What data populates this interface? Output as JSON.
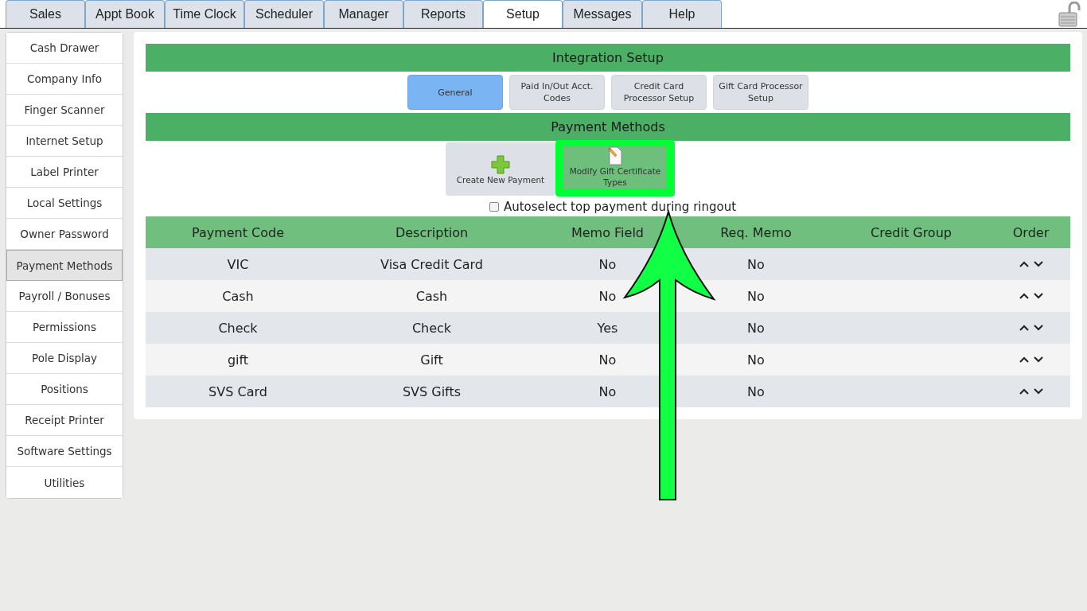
{
  "tabs": [
    {
      "label": "Sales",
      "selected": false
    },
    {
      "label": "Appt Book",
      "selected": false
    },
    {
      "label": "Time Clock",
      "selected": false
    },
    {
      "label": "Scheduler",
      "selected": false
    },
    {
      "label": "Manager",
      "selected": false
    },
    {
      "label": "Reports",
      "selected": false
    },
    {
      "label": "Setup",
      "selected": true
    },
    {
      "label": "Messages",
      "selected": false
    },
    {
      "label": "Help",
      "selected": false
    }
  ],
  "sidebar": {
    "items": [
      {
        "label": "Cash Drawer",
        "selected": false
      },
      {
        "label": "Company Info",
        "selected": false
      },
      {
        "label": "Finger Scanner",
        "selected": false
      },
      {
        "label": "Internet Setup",
        "selected": false
      },
      {
        "label": "Label Printer",
        "selected": false
      },
      {
        "label": "Local Settings",
        "selected": false
      },
      {
        "label": "Owner Password",
        "selected": false
      },
      {
        "label": "Payment Methods",
        "selected": true
      },
      {
        "label": "Payroll / Bonuses",
        "selected": false
      },
      {
        "label": "Permissions",
        "selected": false
      },
      {
        "label": "Pole Display",
        "selected": false
      },
      {
        "label": "Positions",
        "selected": false
      },
      {
        "label": "Receipt Printer",
        "selected": false
      },
      {
        "label": "Software Settings",
        "selected": false
      },
      {
        "label": "Utilities",
        "selected": false
      }
    ]
  },
  "integration": {
    "title": "Integration Setup",
    "buttons": [
      {
        "label": "General",
        "selected": true
      },
      {
        "label": "Paid In/Out Acct. Codes",
        "selected": false
      },
      {
        "label": "Credit Card Processor Setup",
        "selected": false
      },
      {
        "label": "Gift Card Processor Setup",
        "selected": false
      }
    ]
  },
  "payment_methods": {
    "title": "Payment Methods",
    "actions": [
      {
        "label": "Create New Payment",
        "kind": "plus",
        "highlighted": false
      },
      {
        "label": "Modify Gift Certificate Types",
        "kind": "edit",
        "highlighted": true
      }
    ],
    "autoselect": {
      "label": "Autoselect top payment during ringout",
      "checked": false
    }
  },
  "table": {
    "columns": [
      "Payment Code",
      "Description",
      "Memo Field",
      "Req. Memo",
      "Credit Group",
      "Order"
    ],
    "rows": [
      [
        "VIC",
        "Visa Credit Card",
        "No",
        "No"
      ],
      [
        "Cash",
        "Cash",
        "No",
        "No"
      ],
      [
        "Check",
        "Check",
        "Yes",
        "No"
      ],
      [
        "gift",
        "Gift",
        "No",
        "No"
      ],
      [
        "SVS Card",
        "SVS Gifts",
        "No",
        "No"
      ]
    ]
  }
}
